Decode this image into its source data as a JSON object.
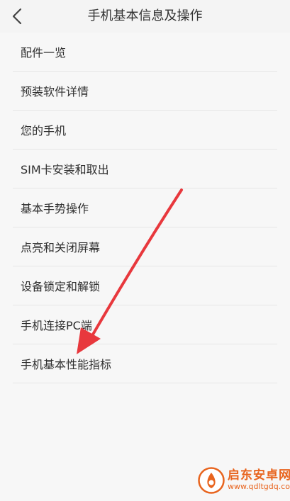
{
  "header": {
    "title": "手机基本信息及操作",
    "back_icon": "chevron-left-icon"
  },
  "list": {
    "items": [
      {
        "label": "配件一览"
      },
      {
        "label": "预装软件详情"
      },
      {
        "label": "您的手机"
      },
      {
        "label": "SIM卡安装和取出"
      },
      {
        "label": "基本手势操作"
      },
      {
        "label": "点亮和关闭屏幕"
      },
      {
        "label": "设备锁定和解锁"
      },
      {
        "label": "手机连接PC端"
      },
      {
        "label": "手机基本性能指标"
      }
    ]
  },
  "annotation": {
    "arrow_color": "#e8383d"
  },
  "watermark": {
    "name": "启东安卓网",
    "url": "www.qdltgdq.com",
    "color": "#e8641e"
  }
}
